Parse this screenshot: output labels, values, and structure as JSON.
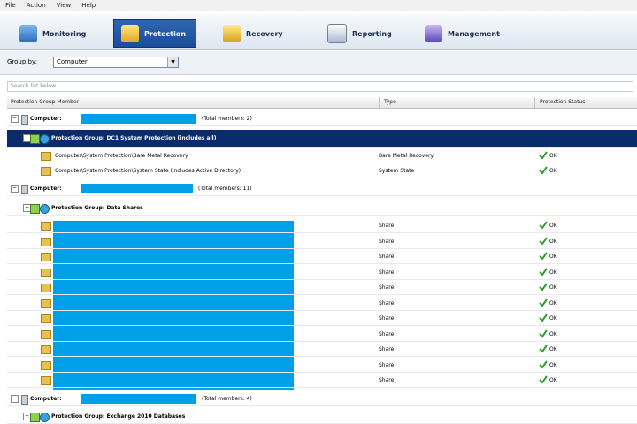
{
  "menu": [
    "File",
    "Action",
    "View",
    "Help"
  ],
  "tabs": [
    {
      "label": "Monitoring",
      "icon": "monitoring-icon",
      "active": false
    },
    {
      "label": "Protection",
      "icon": "protection-icon",
      "active": true
    },
    {
      "label": "Recovery",
      "icon": "recovery-icon",
      "active": false
    },
    {
      "label": "Reporting",
      "icon": "reporting-icon",
      "active": false
    },
    {
      "label": "Management",
      "icon": "management-icon",
      "active": false
    }
  ],
  "group_by": {
    "label": "Group by:",
    "value": "Computer"
  },
  "search": {
    "placeholder": "Search list below"
  },
  "columns": [
    "Protection Group Member",
    "Type",
    "Protection Status"
  ],
  "groups": [
    {
      "computer_label": "Computer:",
      "total": "(Total members: 2)",
      "protection_group": "Protection Group: DC1 System Protection (includes all)",
      "members": [
        {
          "name": "Computer\\System Protection\\Bare Metal Recovery",
          "type": "Bare Metal Recovery",
          "status": "OK"
        },
        {
          "name": "Computer\\System Protection\\System State (includes Active Directory)",
          "type": "System State",
          "status": "OK"
        }
      ]
    },
    {
      "computer_label": "Computer:",
      "total": "(Total members: 11)",
      "protection_group": "Protection Group: Data Shares",
      "members": [
        {
          "type": "Share",
          "status": "OK"
        },
        {
          "type": "Share",
          "status": "OK"
        },
        {
          "type": "Share",
          "status": "OK"
        },
        {
          "type": "Share",
          "status": "OK"
        },
        {
          "type": "Share",
          "status": "OK"
        },
        {
          "type": "Share",
          "status": "OK"
        },
        {
          "type": "Share",
          "status": "OK"
        },
        {
          "type": "Share",
          "status": "OK"
        },
        {
          "type": "Share",
          "status": "OK"
        },
        {
          "type": "Share",
          "status": "OK"
        },
        {
          "type": "Share",
          "status": "OK"
        }
      ]
    },
    {
      "computer_label": "Computer:",
      "total": "(Total members: 4)",
      "protection_group": "Protection Group: Exchange 2010 Databases",
      "members": []
    }
  ],
  "colors": {
    "selected": "#0a2c6c",
    "redaction": "#00a0e8",
    "ok_green": "#2e9f2e"
  }
}
